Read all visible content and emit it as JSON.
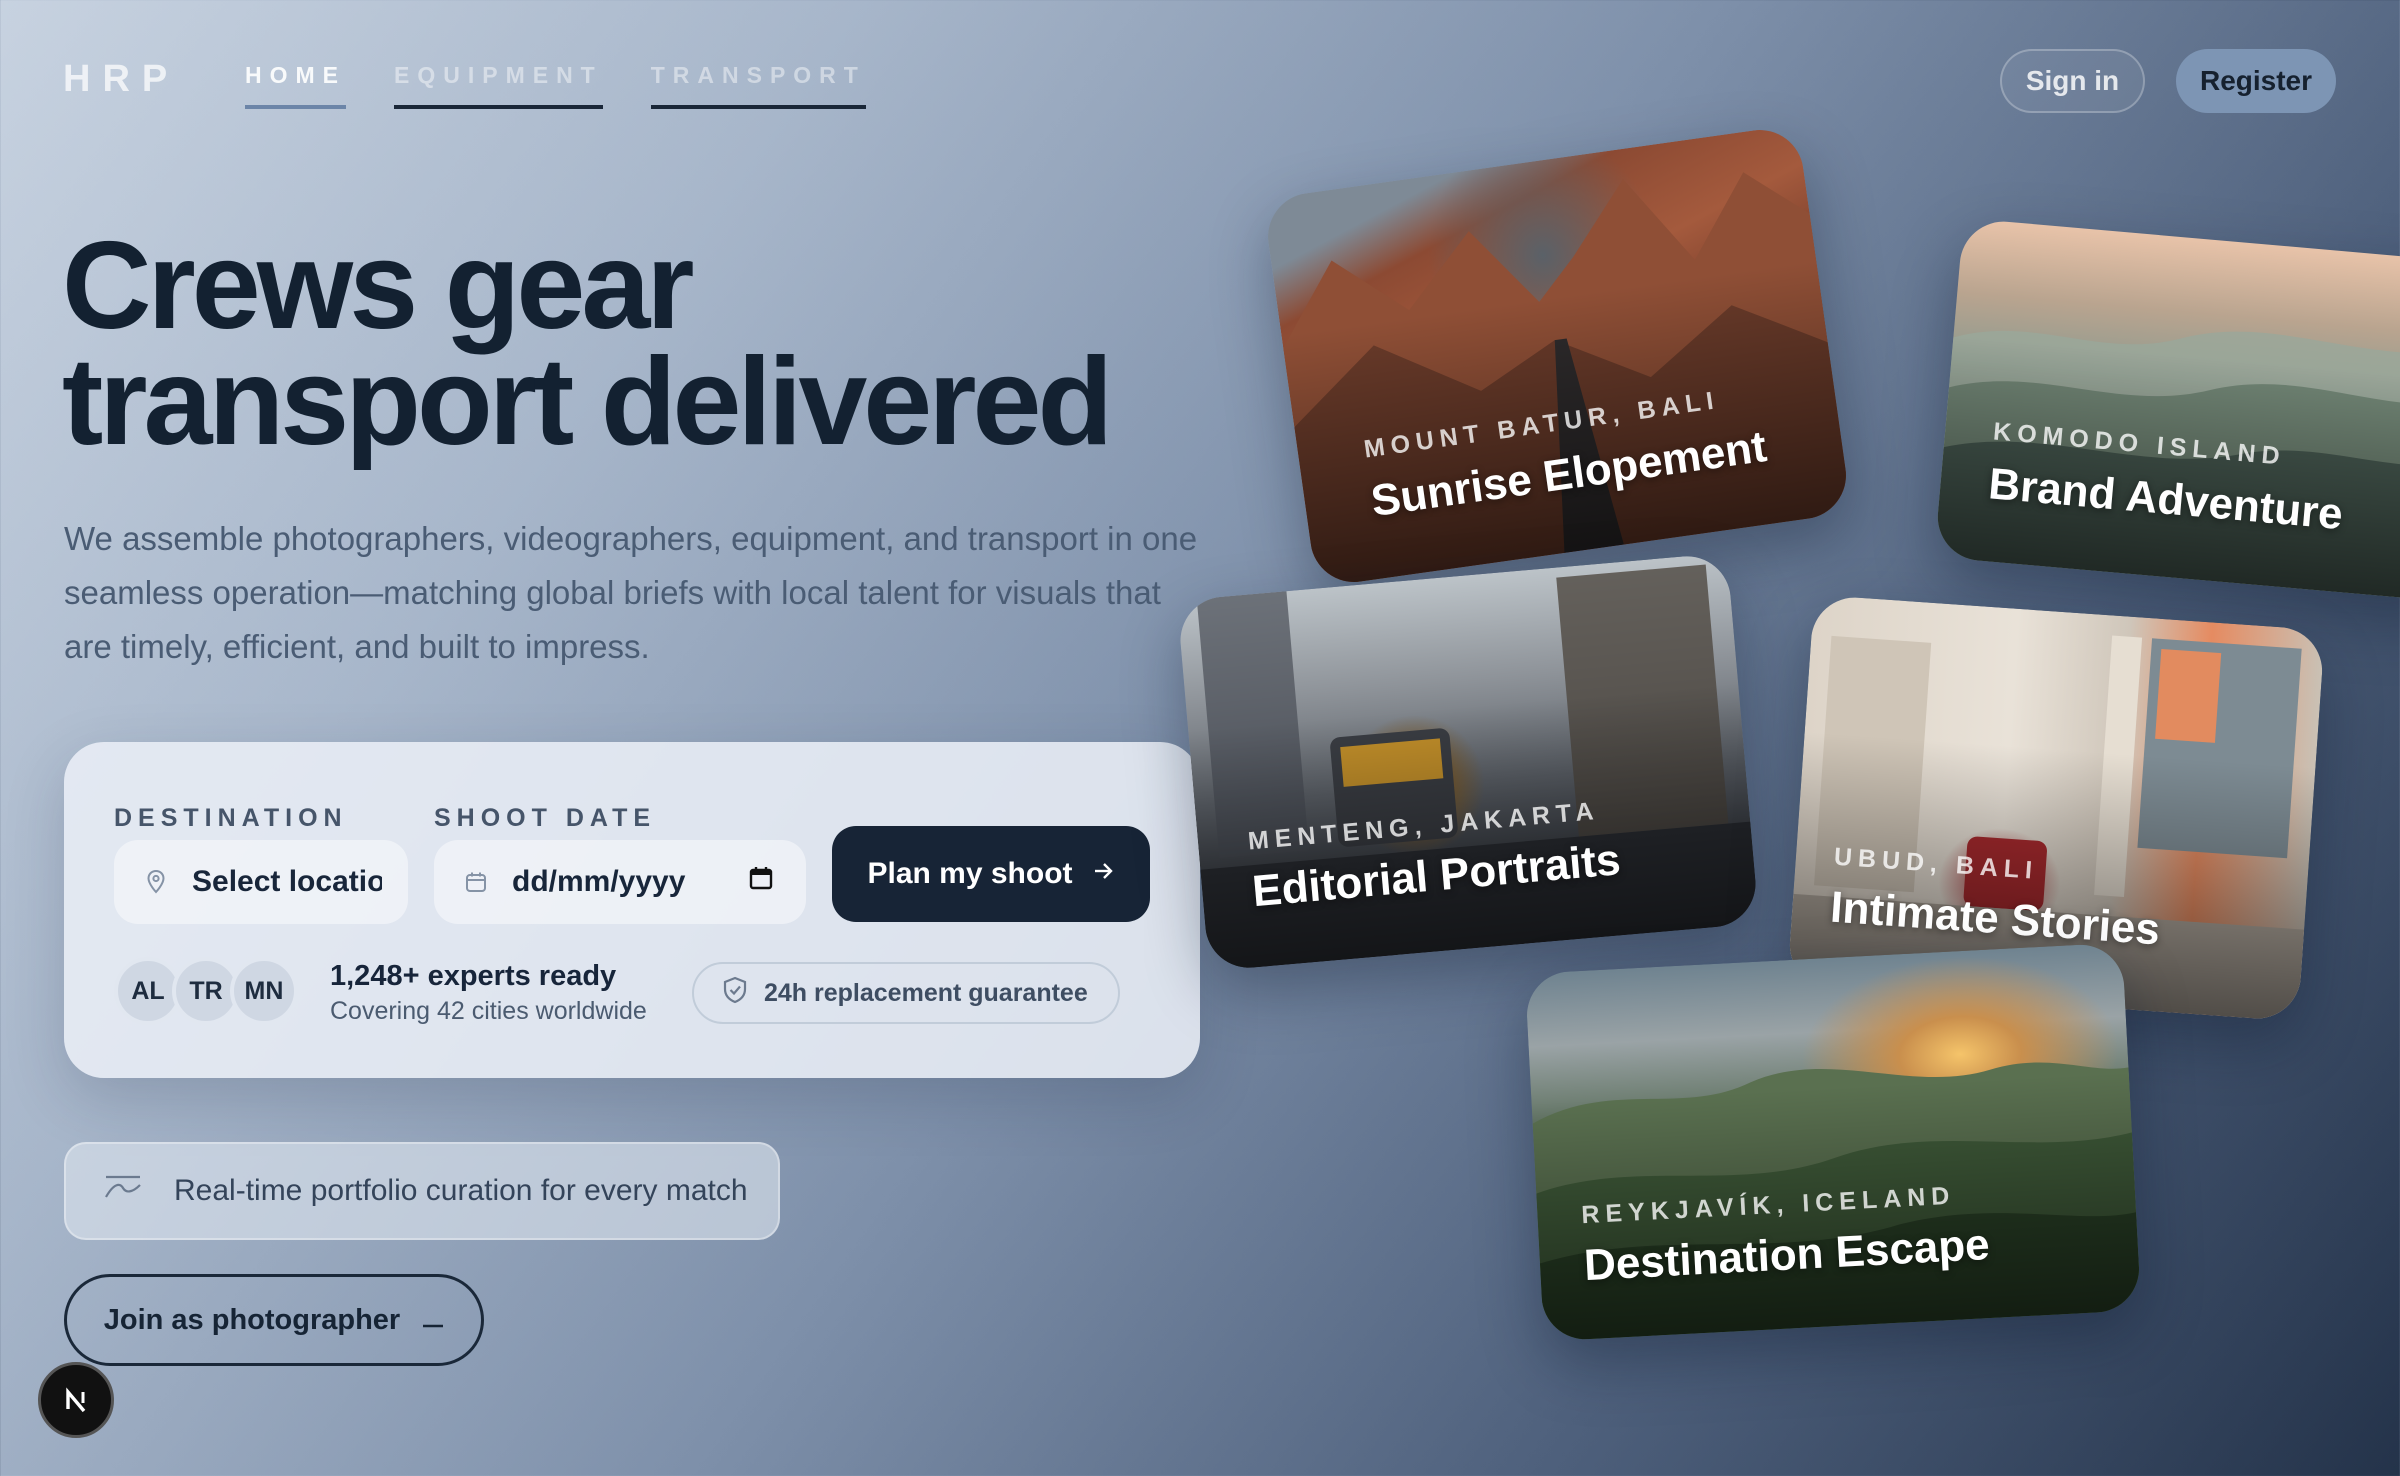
{
  "brand": {
    "logo": "HRP"
  },
  "nav": {
    "items": [
      {
        "label": "HOME",
        "active": true
      },
      {
        "label": "EQUIPMENT",
        "active": false
      },
      {
        "label": "TRANSPORT",
        "active": false
      }
    ]
  },
  "auth": {
    "signin_label": "Sign in",
    "register_label": "Register"
  },
  "hero": {
    "headline_line1": "Crews gear",
    "headline_line2": "transport delivered",
    "subtitle": "We assemble photographers, videographers, equipment, and transport in one seamless operation—matching global briefs with local talent for visuals that are timely, efficient, and built to impress."
  },
  "booking": {
    "destination_label": "DESTINATION",
    "destination_placeholder": "Select location",
    "date_label": "SHOOT DATE",
    "date_placeholder": "dd/mm/yyyy",
    "cta_label": "Plan my shoot",
    "avatars": [
      "AL",
      "TR",
      "MN"
    ],
    "experts_text": "1,248+ experts ready",
    "cities_text": "Covering 42 cities worldwide",
    "guarantee_text": "24h replacement guarantee"
  },
  "curation_text": "Real-time portfolio curation for every match",
  "join_label": "Join as photographer",
  "cards": [
    {
      "location": "MOUNT BATUR, BALI",
      "title": "Sunrise Elopement"
    },
    {
      "location": "KOMODO ISLAND",
      "title": "Brand Adventure"
    },
    {
      "location": "MENTENG, JAKARTA",
      "title": "Editorial Portraits"
    },
    {
      "location": "UBUD, BALI",
      "title": "Intimate Stories"
    },
    {
      "location": "REYKJAVÍK, ICELAND",
      "title": "Destination Escape"
    }
  ],
  "colors": {
    "primary_dark": "#172436",
    "accent": "#7d95b4",
    "active_underline": "#6c85a8"
  },
  "icons": [
    "map-pin-icon",
    "calendar-icon",
    "arrow-right-icon",
    "shield-check-icon",
    "wave-icon",
    "dash-icon",
    "n-logo-icon"
  ]
}
